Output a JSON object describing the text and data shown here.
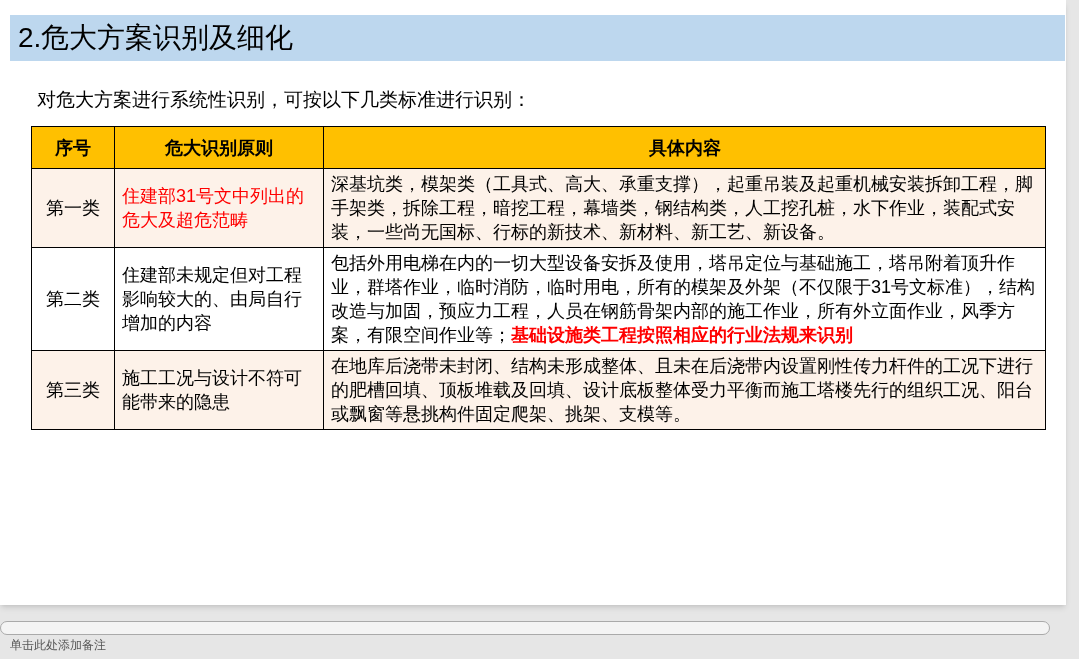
{
  "slide": {
    "title": "2.危大方案识别及细化",
    "intro": "对危大方案进行系统性识别，可按以下几类标准进行识别：",
    "table": {
      "columns": [
        "序号",
        "危大识别原则",
        "具体内容"
      ],
      "rows": [
        {
          "number": "第一类",
          "principle": "住建部31号文中列出的危大及超危范畴",
          "principle_highlight": true,
          "shaded": true,
          "content": "深基坑类，模架类（工具式、高大、承重支撑），起重吊装及起重机械安装拆卸工程，脚手架类，拆除工程，暗挖工程，幕墙类，钢结构类，人工挖孔桩，水下作业，装配式安装，一些尚无国标、行标的新技术、新材料、新工艺、新设备。"
        },
        {
          "number": "第二类",
          "principle": "住建部未规定但对工程影响较大的、由局自行增加的内容",
          "principle_highlight": false,
          "shaded": false,
          "content": "包括外用电梯在内的一切大型设备安拆及使用，塔吊定位与基础施工，塔吊附着顶升作业，群塔作业，临时消防，临时用电，所有的模架及外架（不仅限于31号文标准），结构改造与加固，预应力工程，人员在钢筋骨架内部的施工作业，所有外立面作业，风季方案，有限空间作业等；",
          "emphasis": "基础设施类工程按照相应的行业法规来识别"
        },
        {
          "number": "第三类",
          "principle": "施工工况与设计不符可能带来的隐患",
          "principle_highlight": false,
          "shaded": true,
          "content": "在地库后浇带未封闭、结构未形成整体、且未在后浇带内设置刚性传力杆件的工况下进行的肥槽回填、顶板堆载及回填、设计底板整体受力平衡而施工塔楼先行的组织工况、阳台或飘窗等悬挑构件固定爬架、挑架、支模等。"
        }
      ]
    }
  },
  "notes": {
    "placeholder": "单击此处添加备注"
  }
}
